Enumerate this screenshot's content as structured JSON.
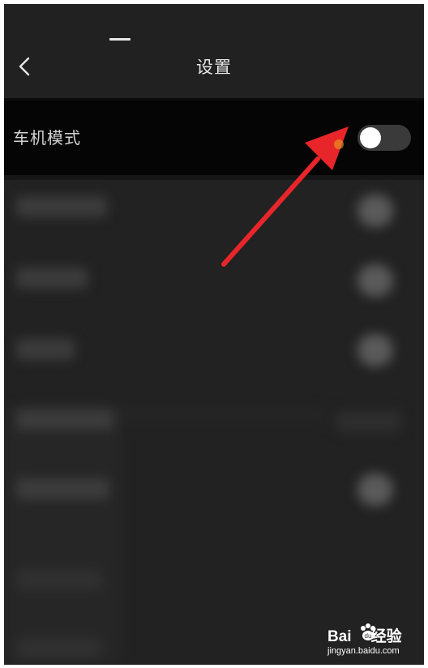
{
  "header": {
    "title": "设置",
    "back_icon": "chevron-left-icon"
  },
  "setting": {
    "label": "车机模式",
    "toggle_state": "off"
  },
  "annotation": {
    "arrow_color": "#e8262a",
    "arrow_icon": "red-arrow-icon"
  },
  "watermark": {
    "logo_text_a": "Bai",
    "logo_text_b": "经验",
    "url": "jingyan.baidu.com"
  },
  "colors": {
    "background": "#222222",
    "setting_row": "#050505",
    "toggle_track": "#3a3a3a",
    "toggle_knob": "#ffffff"
  }
}
